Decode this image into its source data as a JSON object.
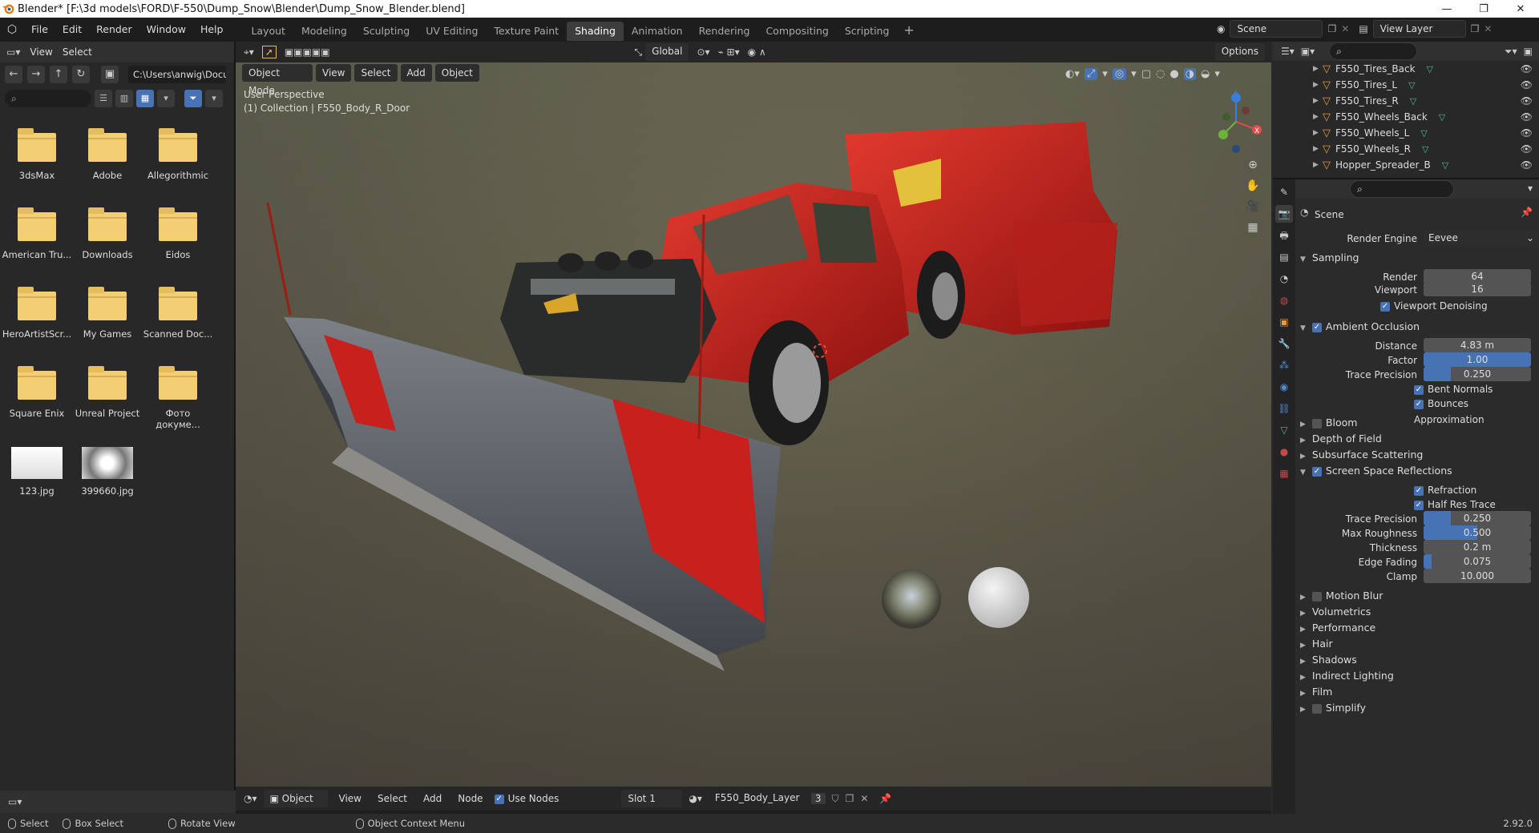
{
  "window": {
    "title": "Blender* [F:\\3d models\\FORD\\F-550\\Dump_Snow\\Blender\\Dump_Snow_Blender.blend]",
    "minimize": "—",
    "restore": "❐",
    "close": "✕"
  },
  "menubar": {
    "items": [
      "File",
      "Edit",
      "Render",
      "Window",
      "Help"
    ],
    "workspaces": [
      "Layout",
      "Modeling",
      "Sculpting",
      "UV Editing",
      "Texture Paint",
      "Shading",
      "Animation",
      "Rendering",
      "Compositing",
      "Scripting"
    ],
    "active_workspace": "Shading",
    "add_tab": "+",
    "scene": "Scene",
    "view_layer": "View Layer"
  },
  "filebrowser": {
    "menu": [
      "View",
      "Select"
    ],
    "path": "C:\\Users\\anwig\\Docu...",
    "items": [
      {
        "name": "3dsMax",
        "kind": "folder"
      },
      {
        "name": "Adobe",
        "kind": "folder"
      },
      {
        "name": "Allegorithmic",
        "kind": "folder"
      },
      {
        "name": "American Tru...",
        "kind": "folder"
      },
      {
        "name": "Downloads",
        "kind": "folder"
      },
      {
        "name": "Eidos",
        "kind": "folder"
      },
      {
        "name": "HeroArtistScr...",
        "kind": "folder"
      },
      {
        "name": "My Games",
        "kind": "folder"
      },
      {
        "name": "Scanned Doc...",
        "kind": "folder"
      },
      {
        "name": "Square Enix",
        "kind": "folder"
      },
      {
        "name": "Unreal Project",
        "kind": "folder"
      },
      {
        "name": "Фото докуме...",
        "kind": "folder"
      },
      {
        "name": "123.jpg",
        "kind": "image"
      },
      {
        "name": "399660.jpg",
        "kind": "image"
      }
    ]
  },
  "viewport": {
    "mode": "Object Mode",
    "menu": [
      "View",
      "Select",
      "Add",
      "Object"
    ],
    "orientation": "Global",
    "options": "Options",
    "perspective": "User Perspective",
    "collection": "(1) Collection | F550_Body_R_Door",
    "gizmo": {
      "x": "X",
      "y": "Y",
      "z": "Z"
    }
  },
  "node_editor": {
    "type": "Object",
    "menu": [
      "View",
      "Select",
      "Add",
      "Node"
    ],
    "use_nodes": "Use Nodes",
    "slot": "Slot 1",
    "material": "F550_Body_Layer",
    "users": "3"
  },
  "outliner": {
    "rows": [
      "F550_Tires_Back",
      "F550_Tires_L",
      "F550_Tires_R",
      "F550_Wheels_Back",
      "F550_Wheels_L",
      "F550_Wheels_R",
      "Hopper_Spreader_B"
    ]
  },
  "properties": {
    "context": "Scene",
    "render_engine_label": "Render Engine",
    "render_engine": "Eevee",
    "sampling": {
      "title": "Sampling",
      "render_label": "Render",
      "render": "64",
      "viewport_label": "Viewport",
      "viewport": "16",
      "denoise": "Viewport Denoising"
    },
    "ao": {
      "title": "Ambient Occlusion",
      "distance_label": "Distance",
      "distance": "4.83 m",
      "factor_label": "Factor",
      "factor": "1.00",
      "factor_fill": 1.0,
      "trace_label": "Trace Precision",
      "trace": "0.250",
      "trace_fill": 0.25,
      "bent": "Bent Normals",
      "bounces": "Bounces Approximation"
    },
    "collapsed1": [
      "Bloom",
      "Depth of Field",
      "Subsurface Scattering"
    ],
    "ssr": {
      "title": "Screen Space Reflections",
      "refraction": "Refraction",
      "half_res": "Half Res Trace",
      "trace_label": "Trace Precision",
      "trace": "0.250",
      "trace_fill": 0.25,
      "roughness_label": "Max Roughness",
      "roughness": "0.500",
      "roughness_fill": 0.5,
      "thickness_label": "Thickness",
      "thickness": "0.2 m",
      "edge_label": "Edge Fading",
      "edge": "0.075",
      "edge_fill": 0.075,
      "clamp_label": "Clamp",
      "clamp": "10.000"
    },
    "collapsed2": [
      "Motion Blur",
      "Volumetrics",
      "Performance",
      "Hair",
      "Shadows",
      "Indirect Lighting",
      "Film",
      "Simplify"
    ]
  },
  "statusbar": {
    "select": "Select",
    "box_select": "Box Select",
    "rotate": "Rotate View",
    "context_menu": "Object Context Menu",
    "version": "2.92.0"
  },
  "colors": {
    "accent": "#4772b3",
    "truck_red": "#c8201d",
    "plow_gray": "#5d6368",
    "folder": "#f3ce74"
  }
}
